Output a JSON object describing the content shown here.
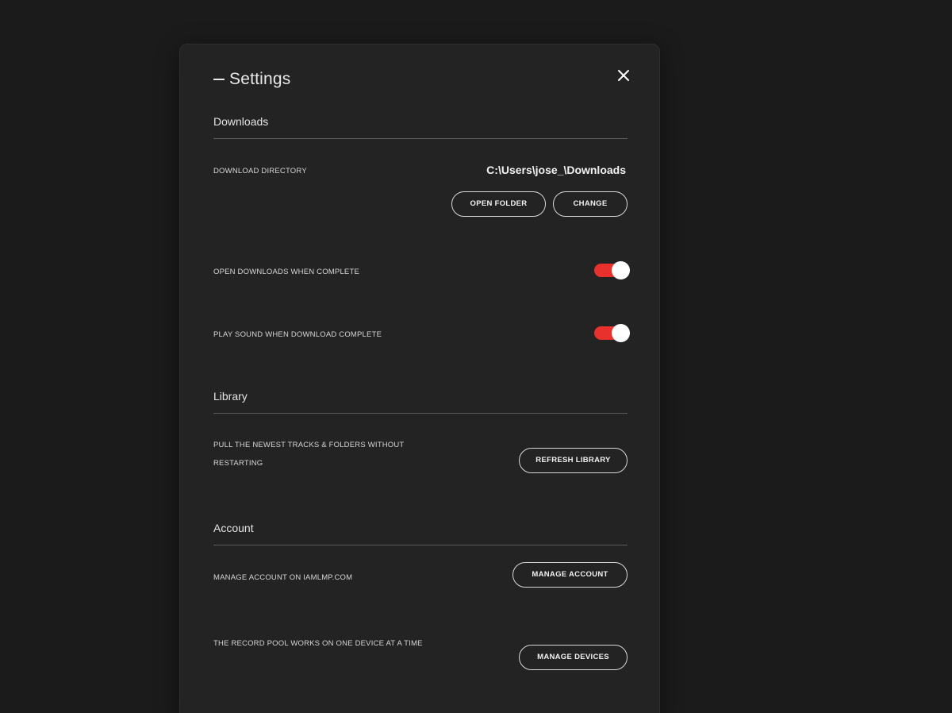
{
  "header": {
    "title": "Settings"
  },
  "downloads": {
    "section_title": "Downloads",
    "directory_label": "DOWNLOAD DIRECTORY",
    "directory_path": "C:\\Users\\jose_\\Downloads",
    "open_folder_label": "OPEN FOLDER",
    "change_label": "CHANGE",
    "open_when_complete_label": "OPEN DOWNLOADS WHEN COMPLETE",
    "open_when_complete_on": true,
    "play_sound_label": "PLAY SOUND WHEN DOWNLOAD COMPLETE",
    "play_sound_on": true
  },
  "library": {
    "section_title": "Library",
    "refresh_line1": "PULL THE NEWEST TRACKS & FOLDERS WITHOUT",
    "refresh_line2": "RESTARTING",
    "refresh_button_label": "REFRESH LIBRARY"
  },
  "account": {
    "section_title": "Account",
    "manage_account_label": "MANAGE ACCOUNT ON IAMLMP.COM",
    "manage_account_button_label": "MANAGE ACCOUNT",
    "devices_label": "THE RECORD POOL WORKS ON ONE DEVICE AT A TIME",
    "manage_devices_button_label": "MANAGE DEVICES"
  },
  "colors": {
    "background": "#1b1b1b",
    "panel": "#232323",
    "accent": "#e8302c",
    "divider": "#5a5a5a"
  },
  "icons": {
    "close": "close-icon",
    "title_dash": "dash-icon"
  }
}
